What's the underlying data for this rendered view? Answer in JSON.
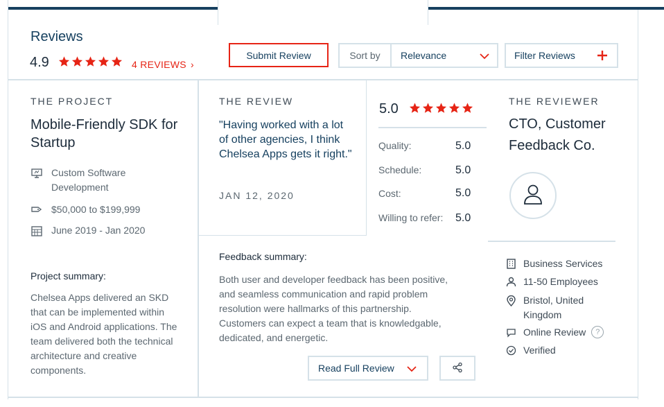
{
  "header": {
    "title": "Reviews",
    "rating": "4.9",
    "star_count": 5,
    "reviews_link": "4 REVIEWS",
    "reviews_link_chevron": "›"
  },
  "toolbar": {
    "submit_label": "Submit Review",
    "sort_label": "Sort by",
    "sort_value": "Relevance",
    "filter_label": "Filter Reviews"
  },
  "project": {
    "section_label": "THE PROJECT",
    "title": "Mobile-Friendly SDK for Startup",
    "service": "Custom Software Development",
    "budget": "$50,000 to $199,999",
    "timeline": "June 2019 - Jan 2020",
    "summary_label": "Project summary:",
    "summary": "Chelsea Apps delivered an SKD that can be implemented within iOS and Android applications. The team delivered both the technical architecture and creative components."
  },
  "review": {
    "section_label": "THE REVIEW",
    "quote": "\"Having worked with a lot of other agencies, I think Chelsea Apps gets it right.\"",
    "date": "JAN 12, 2020",
    "overall": "5.0",
    "scores": [
      {
        "label": "Quality:",
        "value": "5.0"
      },
      {
        "label": "Schedule:",
        "value": "5.0"
      },
      {
        "label": "Cost:",
        "value": "5.0"
      },
      {
        "label": "Willing to refer:",
        "value": "5.0"
      }
    ],
    "feedback_label": "Feedback summary:",
    "feedback": "Both user and developer feedback has been positive, and seamless communication and rapid problem resolution were hallmarks of this partnership. Customers can expect a team that is knowledgable, dedicated, and energetic.",
    "read_full_label": "Read Full Review"
  },
  "reviewer": {
    "section_label": "THE REVIEWER",
    "title": "CTO, Customer Feedback Co.",
    "industry": "Business Services",
    "size": "11-50 Employees",
    "location": "Bristol, United Kingdom",
    "review_type": "Online Review",
    "help_glyph": "?",
    "status": "Verified"
  },
  "colors": {
    "accent_red": "#e62415",
    "navy": "#16405f",
    "border": "#d5e1e8"
  },
  "icons": {
    "star": "star-icon",
    "chevron_down": "chevron-down-icon",
    "plus": "plus-icon",
    "share": "share-icon",
    "user": "user-icon",
    "monitor": "monitor-icon",
    "price_tag": "price-tag-icon",
    "calendar": "calendar-icon",
    "building": "building-icon",
    "person": "person-icon",
    "location": "location-pin-icon",
    "chat": "chat-icon",
    "check": "check-circle-icon"
  }
}
